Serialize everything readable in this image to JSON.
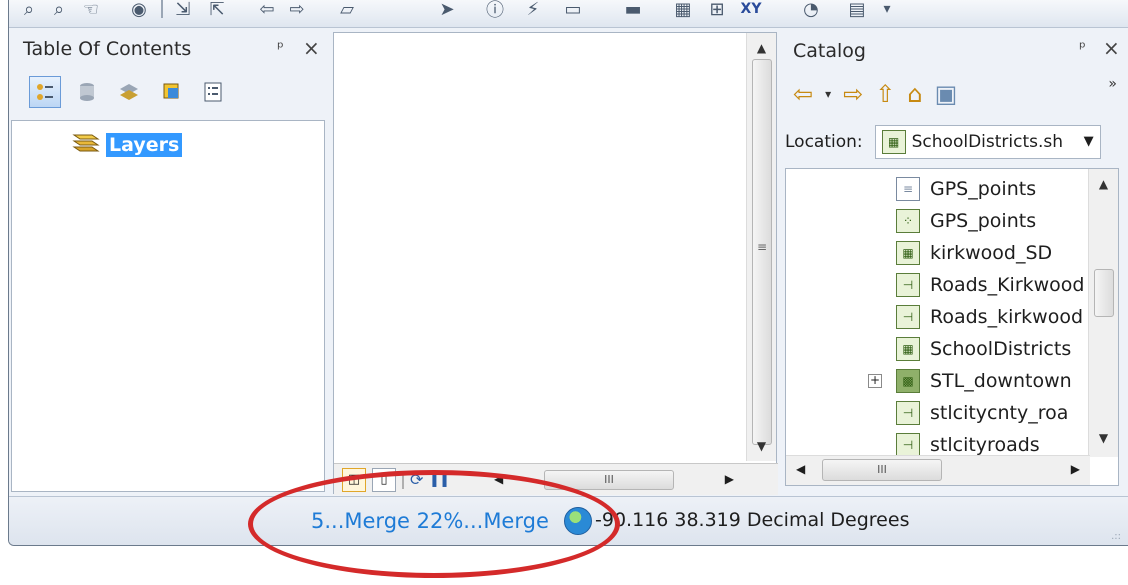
{
  "toc": {
    "title": "Table Of Contents",
    "pin_label": "ᵖ",
    "close_label": "×",
    "root_layer": "Layers"
  },
  "catalog": {
    "title": "Catalog",
    "pin_label": "ᵖ",
    "close_label": "×",
    "overflow_label": "»",
    "location_label": "Location:",
    "location_value": "SchoolDistricts.sh",
    "items": [
      {
        "label": "GPS_points",
        "icon": "table-icon"
      },
      {
        "label": "GPS_points",
        "icon": "point-shapefile-icon"
      },
      {
        "label": "kirkwood_SD",
        "icon": "polygon-shapefile-icon"
      },
      {
        "label": "Roads_Kirkwood",
        "icon": "line-shapefile-icon"
      },
      {
        "label": "Roads_kirkwood",
        "icon": "line-shapefile-icon"
      },
      {
        "label": "SchoolDistricts",
        "icon": "polygon-shapefile-icon"
      },
      {
        "label": "STL_downtown",
        "icon": "raster-icon"
      },
      {
        "label": "stlcitycnty_roa",
        "icon": "line-shapefile-icon"
      },
      {
        "label": "stlcityroads",
        "icon": "line-shapefile-icon"
      }
    ]
  },
  "map": {
    "scroll_mid_label": "≡",
    "hscroll_thumb_label": "III"
  },
  "status": {
    "progress_text": "5...Merge 22%...Merge",
    "coordinates": "-90.116  38.319 Decimal Degrees"
  },
  "colors": {
    "accent": "#3399ff",
    "progress_text": "#1e7bd6",
    "annotation": "#d42a2a"
  }
}
